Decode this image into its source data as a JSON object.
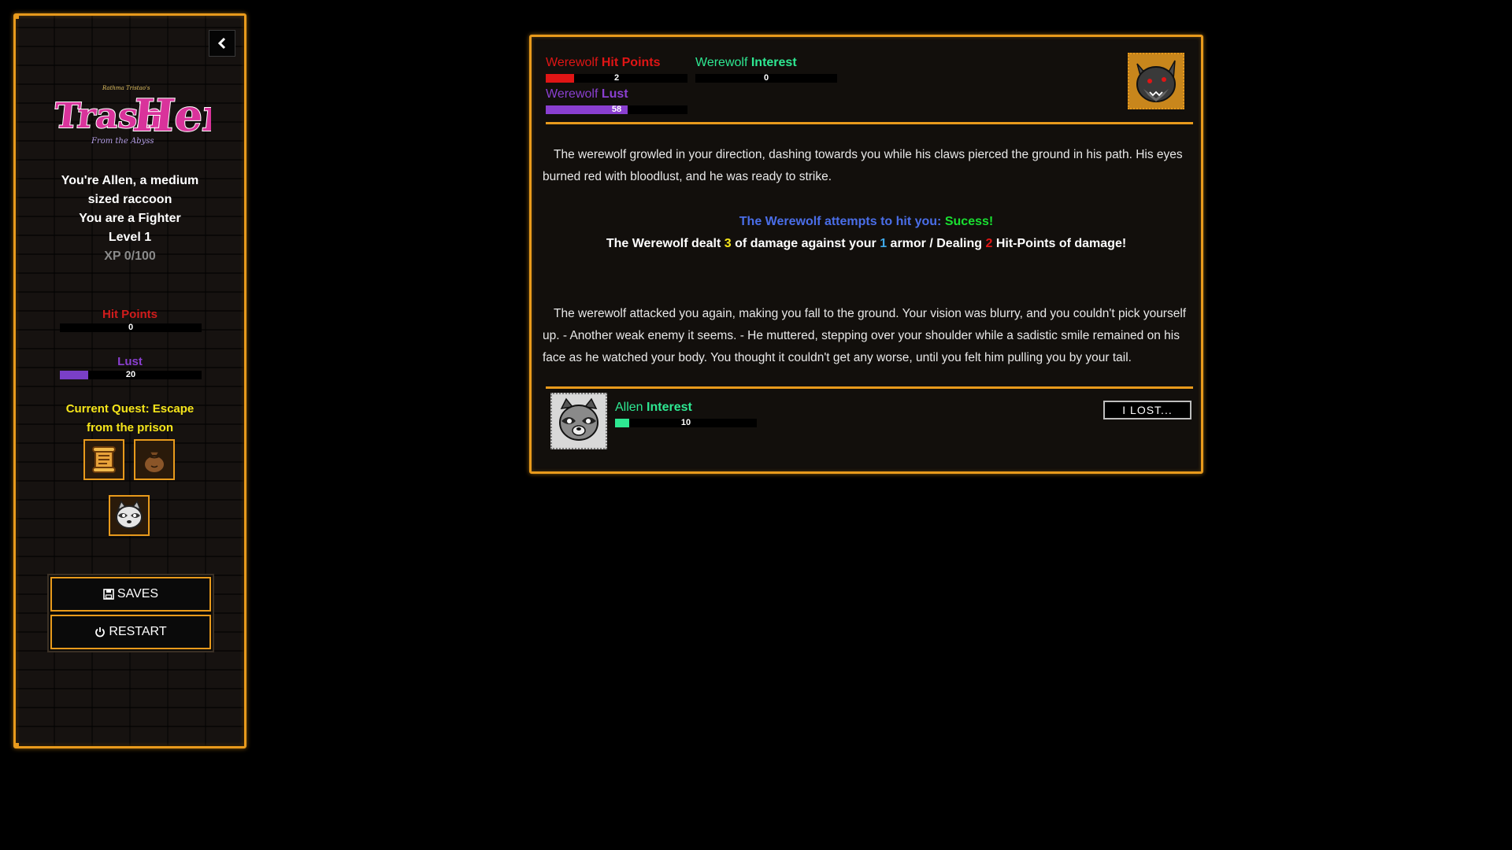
{
  "sidebar": {
    "collapse_icon": "chevron-left-icon",
    "logo": {
      "small_text": "Rathma Tristao's",
      "word1": "Trash",
      "word2": "Hero",
      "sub": "From the Abyss",
      "colors": {
        "fill": "#d9339b",
        "outline": "#ffffff"
      }
    },
    "intro_line1": "You're Allen, a medium",
    "intro_line2": "sized raccoon",
    "class_line": "You are a Fighter",
    "level_line": "Level 1",
    "xp_line": "XP 0/100",
    "hit_points": {
      "label": "Hit Points",
      "value": 0,
      "max": 100,
      "color": "#d11c1c"
    },
    "lust": {
      "label": "Lust",
      "value": 20,
      "max": 100,
      "color": "#7a3fc7"
    },
    "quest_line1": "Current Quest: Escape",
    "quest_line2": "from the prison",
    "icons": [
      "scroll-icon",
      "bag-icon",
      "raccoon-portrait-icon"
    ],
    "saves_label": "SAVES",
    "restart_label": "RESTART"
  },
  "enemy": {
    "hp": {
      "name": "Werewolf",
      "label": "Hit Points",
      "value": 2,
      "max": 10,
      "color": "#e01515"
    },
    "interest": {
      "name": "Werewolf",
      "label": "Interest",
      "value": 0,
      "max": 100,
      "color": "#2ee892"
    },
    "lust": {
      "name": "Werewolf",
      "label": "Lust",
      "value": 58,
      "max": 100,
      "color": "#8a3fd0"
    },
    "portrait_icon": "werewolf-portrait-icon"
  },
  "combat_log": {
    "para1": "The werewolf growled in your direction, dashing towards you while his claws pierced the ground in his path. His eyes burned red with bloodlust, and he was ready to strike.",
    "attack_prefix": "The Werewolf attempts to hit you:",
    "attack_result": "Sucess!",
    "dmg_a": "The Werewolf dealt",
    "dmg_value": "3",
    "dmg_b": "of damage against your",
    "armor_value": "1",
    "dmg_c": "armor / Dealing",
    "hp_value": "2",
    "dmg_d": "Hit-Points of damage!",
    "para2": "The werewolf attacked you again, making you fall to the ground. Your vision was blurry, and you couldn't pick yourself up. - Another weak enemy it seems. - He muttered, stepping over your shoulder while a sadistic smile remained on his face as he watched your body. You thought it couldn't get any worse, until you felt him pulling you by your tail."
  },
  "player": {
    "interest": {
      "name": "Allen",
      "label": "Interest",
      "value": 10,
      "max": 100,
      "color": "#2ee892"
    },
    "portrait_icon": "allen-raccoon-portrait-icon"
  },
  "lost_button": "I LOST..."
}
